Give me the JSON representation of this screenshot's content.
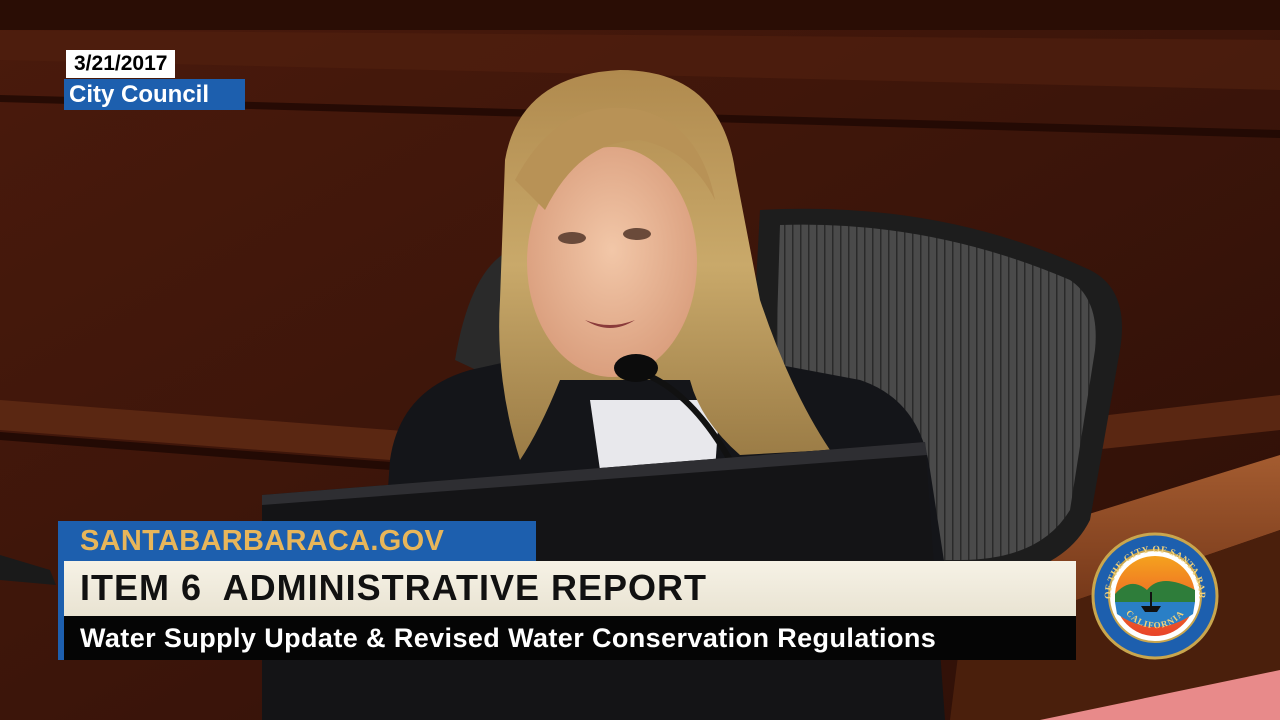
{
  "overlay": {
    "date": "3/21/2017",
    "channel": "City Council",
    "website": "SANTABARBARACA.GOV",
    "item_title": "ITEM 6  ADMINISTRATIVE REPORT",
    "item_description": "Water Supply Update & Revised Water Conservation Regulations"
  },
  "seal": {
    "ring_text_top": "SEAL OF THE CITY OF SANTA BARBARA",
    "ring_text_bottom": "CALIFORNIA"
  },
  "colors": {
    "accent_blue": "#1d5fae",
    "website_gold": "#e8b65a",
    "title_bar": "#f6f2e6",
    "description_bar": "#050505",
    "wood": "#3a150b"
  }
}
